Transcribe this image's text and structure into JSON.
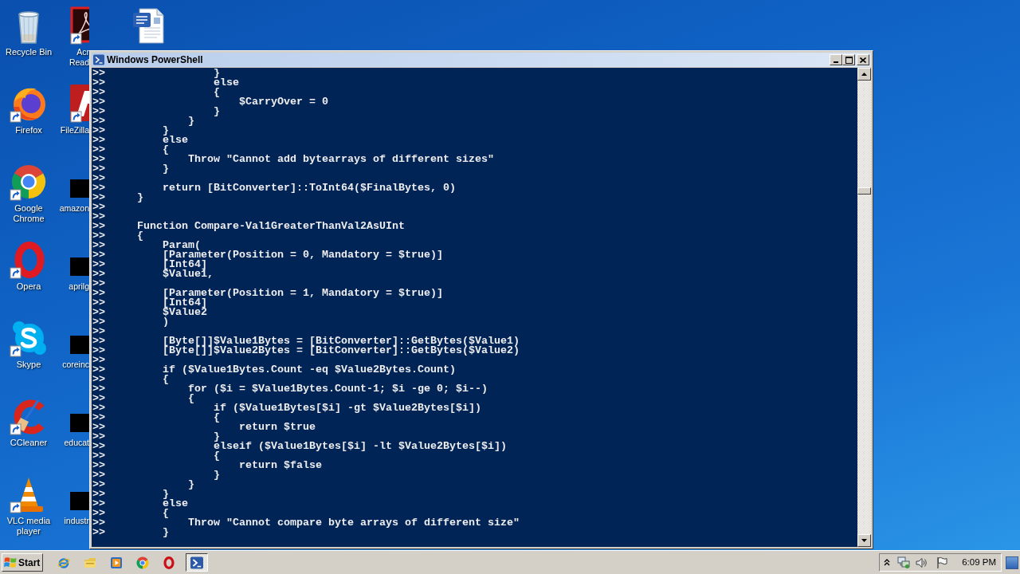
{
  "desktop": {
    "columns": [
      {
        "icons": [
          {
            "kind": "recycle-bin",
            "label": "Recycle Bin",
            "shortcut": false
          },
          {
            "kind": "firefox",
            "label": "Firefox",
            "shortcut": true
          },
          {
            "kind": "chrome",
            "label": "Google Chrome",
            "shortcut": true
          },
          {
            "kind": "opera",
            "label": "Opera",
            "shortcut": true
          },
          {
            "kind": "skype",
            "label": "Skype",
            "shortcut": true
          },
          {
            "kind": "ccleaner",
            "label": "CCleaner",
            "shortcut": true
          },
          {
            "kind": "vlc",
            "label": "VLC media player",
            "shortcut": true
          }
        ]
      },
      {
        "icons": [
          {
            "kind": "acrobat",
            "label": "Acr Read",
            "shortcut": true
          },
          {
            "kind": "filezilla",
            "label": "FileZilla",
            "shortcut": true
          },
          {
            "kind": "thumbnail",
            "label": "amazon",
            "shortcut": false
          },
          {
            "kind": "thumbnail",
            "label": "aprilg",
            "shortcut": false
          },
          {
            "kind": "thumbnail",
            "label": "coreinc",
            "shortcut": false
          },
          {
            "kind": "thumbnail",
            "label": "educat",
            "shortcut": false
          },
          {
            "kind": "thumbnail",
            "label": "industr",
            "shortcut": false
          }
        ]
      },
      {
        "icons": [
          {
            "kind": "word-document",
            "shortcut": false
          }
        ]
      }
    ]
  },
  "window": {
    "title": "Windows PowerShell",
    "lines": [
      {
        "prompt": ">>",
        "code": "                }"
      },
      {
        "prompt": ">>",
        "code": "                else"
      },
      {
        "prompt": ">>",
        "code": "                {"
      },
      {
        "prompt": ">>",
        "code": "                    $CarryOver = 0"
      },
      {
        "prompt": ">>",
        "code": "                }"
      },
      {
        "prompt": ">>",
        "code": "            }"
      },
      {
        "prompt": ">>",
        "code": "        }"
      },
      {
        "prompt": ">>",
        "code": "        else"
      },
      {
        "prompt": ">>",
        "code": "        {"
      },
      {
        "prompt": ">>",
        "code": "            Throw \"Cannot add bytearrays of different sizes\""
      },
      {
        "prompt": ">>",
        "code": "        }"
      },
      {
        "prompt": ">>"
      },
      {
        "prompt": ">>",
        "code": "        return [BitConverter]::ToInt64($FinalBytes, 0)"
      },
      {
        "prompt": ">>",
        "code": "    }"
      },
      {
        "prompt": ">>"
      },
      {
        "prompt": ">>"
      },
      {
        "prompt": ">>",
        "code": "    Function Compare-Val1GreaterThanVal2AsUInt"
      },
      {
        "prompt": ">>",
        "code": "    {"
      },
      {
        "prompt": ">>",
        "code": "        Param("
      },
      {
        "prompt": ">>",
        "code": "        [Parameter(Position = 0, Mandatory = $true)]"
      },
      {
        "prompt": ">>",
        "code": "        [Int64]"
      },
      {
        "prompt": ">>",
        "code": "        $Value1,"
      },
      {
        "prompt": ">>"
      },
      {
        "prompt": ">>",
        "code": "        [Parameter(Position = 1, Mandatory = $true)]"
      },
      {
        "prompt": ">>",
        "code": "        [Int64]"
      },
      {
        "prompt": ">>",
        "code": "        $Value2"
      },
      {
        "prompt": ">>",
        "code": "        )"
      },
      {
        "prompt": ">>"
      },
      {
        "prompt": ">>",
        "code": "        [Byte[]]$Value1Bytes = [BitConverter]::GetBytes($Value1)"
      },
      {
        "prompt": ">>",
        "code": "        [Byte[]]$Value2Bytes = [BitConverter]::GetBytes($Value2)"
      },
      {
        "prompt": ">>"
      },
      {
        "prompt": ">>",
        "code": "        if ($Value1Bytes.Count -eq $Value2Bytes.Count)"
      },
      {
        "prompt": ">>",
        "code": "        {"
      },
      {
        "prompt": ">>",
        "code": "            for ($i = $Value1Bytes.Count-1; $i -ge 0; $i--)"
      },
      {
        "prompt": ">>",
        "code": "            {"
      },
      {
        "prompt": ">>",
        "code": "                if ($Value1Bytes[$i] -gt $Value2Bytes[$i])"
      },
      {
        "prompt": ">>",
        "code": "                {"
      },
      {
        "prompt": ">>",
        "code": "                    return $true"
      },
      {
        "prompt": ">>",
        "code": "                }"
      },
      {
        "prompt": ">>",
        "code": "                elseif ($Value1Bytes[$i] -lt $Value2Bytes[$i])"
      },
      {
        "prompt": ">>",
        "code": "                {"
      },
      {
        "prompt": ">>",
        "code": "                    return $false"
      },
      {
        "prompt": ">>",
        "code": "                }"
      },
      {
        "prompt": ">>",
        "code": "            }"
      },
      {
        "prompt": ">>",
        "code": "        }"
      },
      {
        "prompt": ">>",
        "code": "        else"
      },
      {
        "prompt": ">>",
        "code": "        {"
      },
      {
        "prompt": ">>",
        "code": "            Throw \"Cannot compare byte arrays of different size\""
      },
      {
        "prompt": ">>",
        "code": "        }"
      }
    ]
  },
  "taskbar": {
    "start_label": "Start",
    "quick_launch": [
      {
        "kind": "ie"
      },
      {
        "kind": "explorer"
      },
      {
        "kind": "media-player"
      },
      {
        "kind": "chrome"
      },
      {
        "kind": "opera"
      }
    ],
    "tasks": [
      {
        "kind": "powershell",
        "selected": true
      }
    ],
    "clock": "6:09 PM"
  }
}
